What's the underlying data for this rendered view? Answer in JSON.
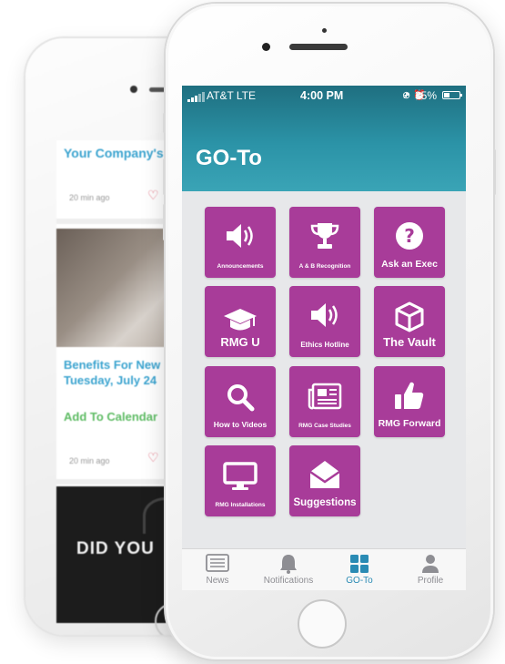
{
  "background_phone": {
    "card_title": "Your Company's",
    "card_time_1": "20 min ago",
    "headline_line1": "Benefits For New",
    "headline_line2": "Tuesday, July 24",
    "add_to_calendar": "Add To Calendar",
    "card_time_2": "20 min ago",
    "dark_text": "DID YOU"
  },
  "status_bar": {
    "carrier": "AT&T  LTE",
    "time": "4:00 PM",
    "battery_pct": "35%"
  },
  "header": {
    "title": "GO-To"
  },
  "tiles": [
    {
      "label": "Announcements",
      "icon": "speaker-icon"
    },
    {
      "label": "A & B  Recognition",
      "icon": "trophy-icon"
    },
    {
      "label": "Ask an Exec",
      "icon": "question-icon"
    },
    {
      "label": "RMG U",
      "icon": "graduation-cap-icon"
    },
    {
      "label": "Ethics Hotline",
      "icon": "speaker-icon"
    },
    {
      "label": "The Vault",
      "icon": "cube-icon"
    },
    {
      "label": "How to Videos",
      "icon": "search-icon"
    },
    {
      "label": "RMG Case Studies",
      "icon": "newspaper-icon"
    },
    {
      "label": "RMG Forward",
      "icon": "thumbs-up-icon"
    },
    {
      "label": "RMG Installations",
      "icon": "monitor-icon"
    },
    {
      "label": "Suggestions",
      "icon": "envelope-open-icon"
    }
  ],
  "tabs": [
    {
      "label": "News",
      "icon": "news-icon",
      "active": false
    },
    {
      "label": "Notifications",
      "icon": "bell-icon",
      "active": false
    },
    {
      "label": "GO-To",
      "icon": "grid-icon",
      "active": true
    },
    {
      "label": "Profile",
      "icon": "person-icon",
      "active": false
    }
  ],
  "colors": {
    "tile": "#a83c99",
    "header_top": "#1f6f80",
    "header_bottom": "#3aa4b6",
    "active_tab": "#2a8bb4",
    "inactive_tab": "#8e8e93",
    "screen_bg": "#e7e8ea"
  }
}
